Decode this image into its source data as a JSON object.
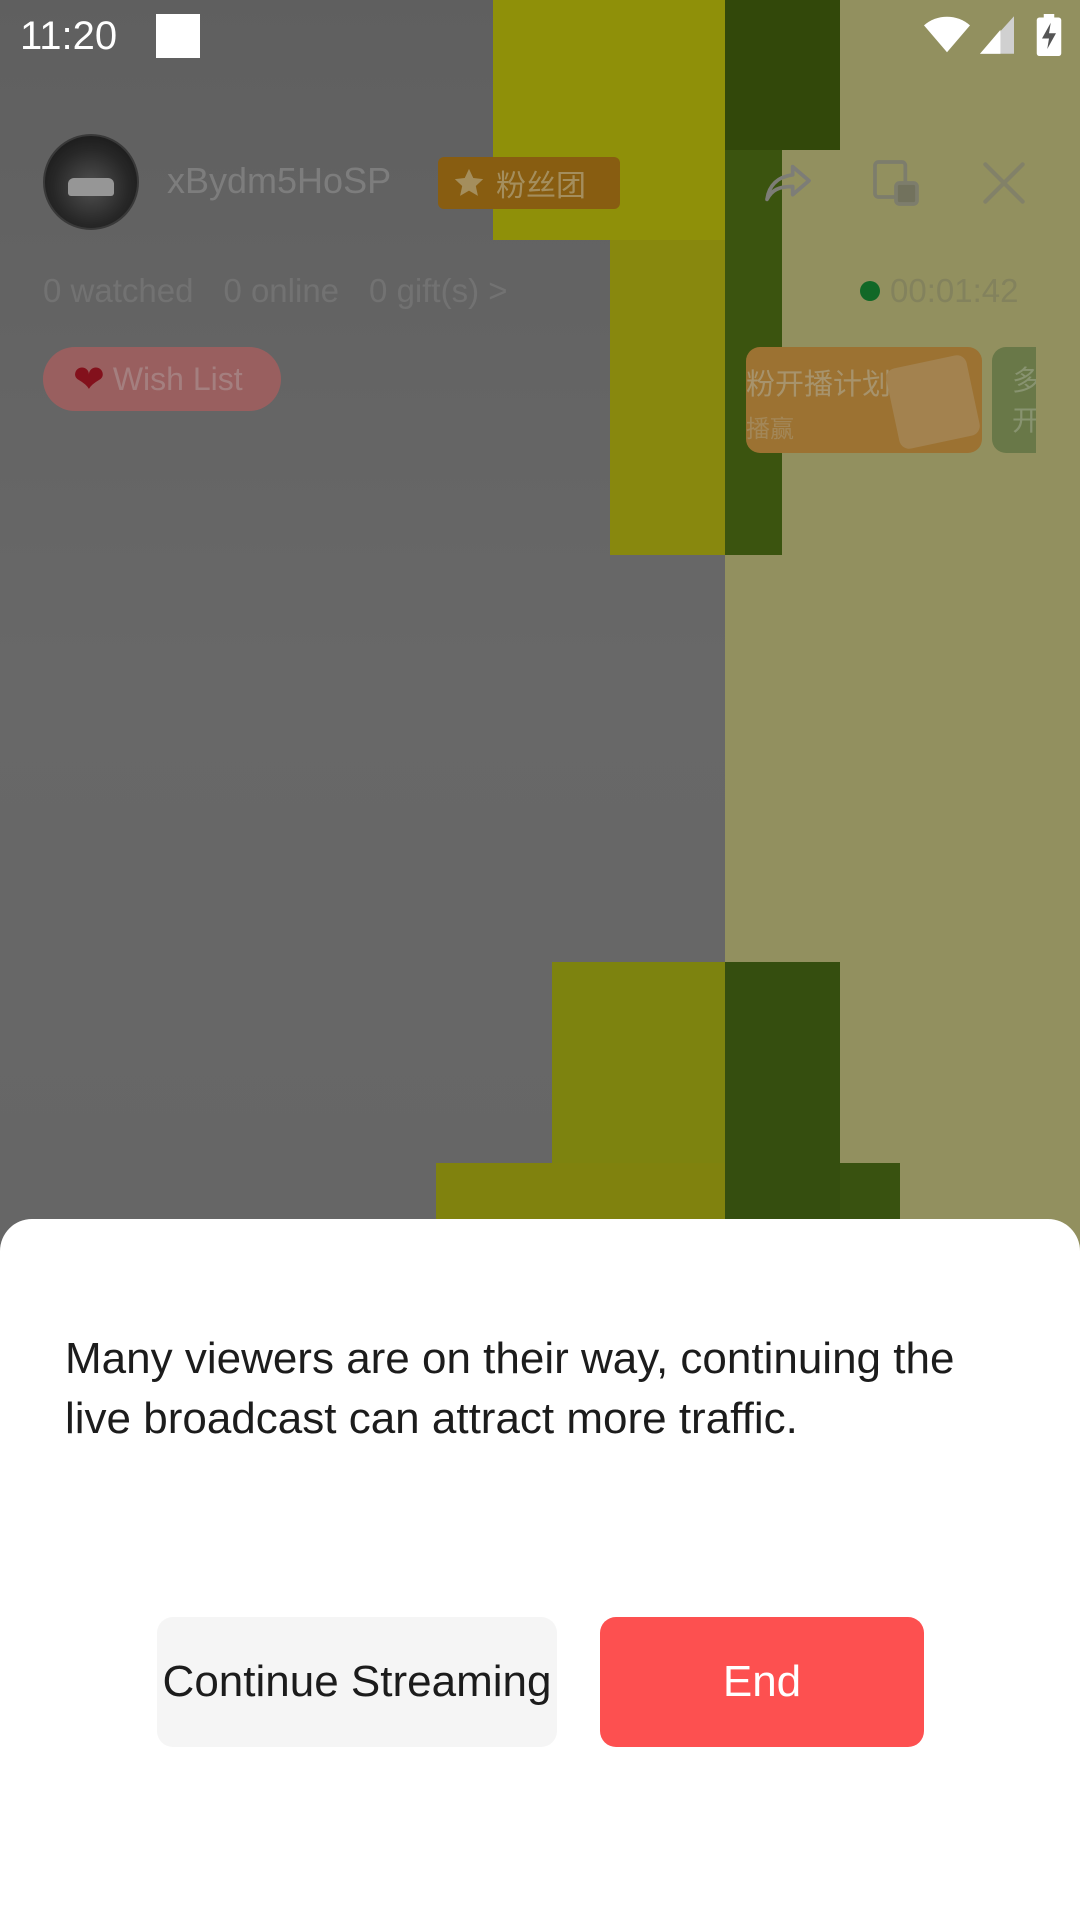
{
  "status_bar": {
    "time": "11:20",
    "icons": [
      "notification-square-icon",
      "wifi-icon",
      "signal-icon",
      "battery-charging-icon"
    ]
  },
  "live_header": {
    "username": "xBydm5HoSP",
    "fan_badge": "粉丝团",
    "stats": {
      "watched": "0 watched",
      "online": "0 online",
      "gifts": "0 gift(s) >"
    },
    "timer": "00:01:42",
    "wish_list": "Wish List",
    "promo": {
      "title": "粉开播计划",
      "subtitle": "播赢"
    },
    "promo2": {
      "line1": "多",
      "line2": "开"
    },
    "icons": [
      "share-icon",
      "picture-in-picture-icon",
      "close-icon"
    ]
  },
  "dialog": {
    "message": "Many viewers are on their way, continuing the live broadcast can attract more traffic.",
    "continue_label": "Continue Streaming",
    "end_label": "End"
  },
  "colors": {
    "end_button": "#fd5050",
    "continue_button": "#f5f5f5",
    "sheet_background": "#ffffff",
    "overlay": "rgba(0,0,0,0.32)"
  }
}
